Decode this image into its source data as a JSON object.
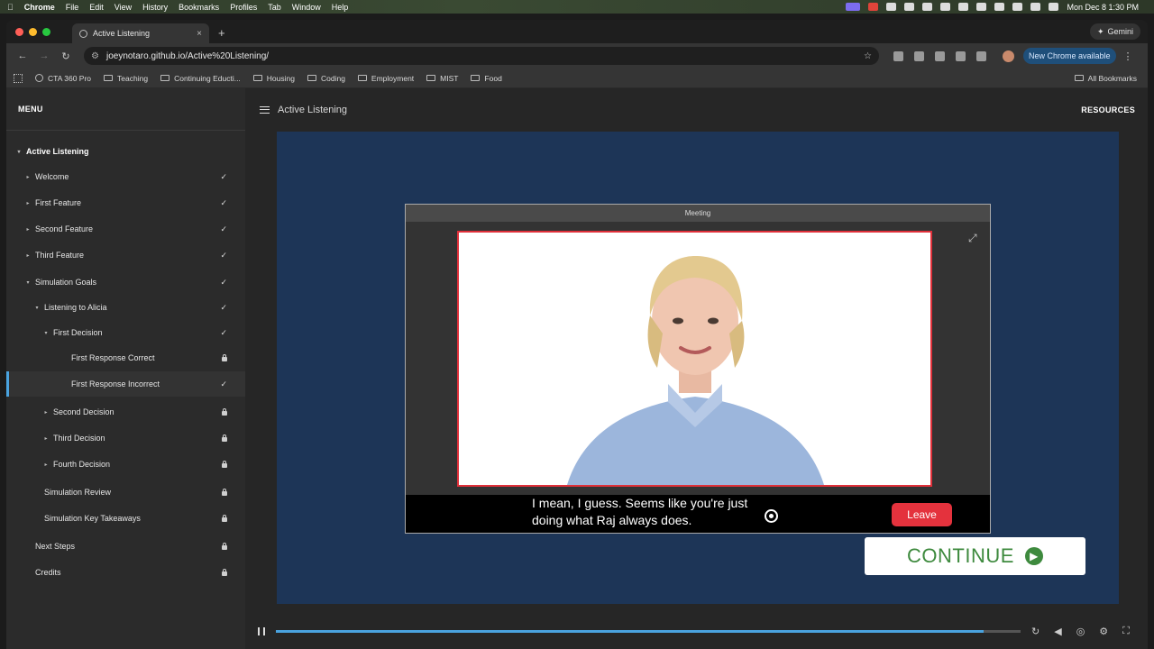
{
  "menubar": {
    "apple": "",
    "items": [
      "Chrome",
      "File",
      "Edit",
      "View",
      "History",
      "Bookmarks",
      "Profiles",
      "Tab",
      "Window",
      "Help"
    ],
    "datetime": "Mon Dec 8  1:30 PM"
  },
  "browser": {
    "tab_title": "Active Listening",
    "new_tab": "+",
    "gemini_label": "Gemini",
    "url": "joeynotaro.github.io/Active%20Listening/",
    "update_label": "New Chrome available",
    "bookmarks": [
      {
        "label": "CTA 360 Pro",
        "type": "site"
      },
      {
        "label": "Teaching",
        "type": "folder"
      },
      {
        "label": "Continuing Educti...",
        "type": "folder"
      },
      {
        "label": "Housing",
        "type": "folder"
      },
      {
        "label": "Coding",
        "type": "folder"
      },
      {
        "label": "Employment",
        "type": "folder"
      },
      {
        "label": "MIST",
        "type": "folder"
      },
      {
        "label": "Food",
        "type": "folder"
      }
    ],
    "all_bookmarks": "All Bookmarks"
  },
  "sidebar": {
    "menu_label": "MENU",
    "items": [
      {
        "label": "Active Listening",
        "level": 0,
        "caret": "▾",
        "status": ""
      },
      {
        "label": "Welcome",
        "level": 1,
        "caret": "▸",
        "status": "✓"
      },
      {
        "label": "First Feature",
        "level": 1,
        "caret": "▸",
        "status": "✓"
      },
      {
        "label": "Second Feature",
        "level": 1,
        "caret": "▸",
        "status": "✓"
      },
      {
        "label": "Third Feature",
        "level": 1,
        "caret": "▸",
        "status": "✓"
      },
      {
        "label": "Simulation Goals",
        "level": 1,
        "caret": "▾",
        "status": "✓"
      },
      {
        "label": "Listening to Alicia",
        "level": 2,
        "caret": "▾",
        "status": "✓"
      },
      {
        "label": "First Decision",
        "level": 3,
        "caret": "▾",
        "status": "✓"
      },
      {
        "label": "First Response Correct",
        "level": 4,
        "caret": "",
        "status": "lock"
      },
      {
        "label": "First Response Incorrect",
        "level": 4,
        "caret": "",
        "status": "✓"
      },
      {
        "label": "Second Decision",
        "level": 3,
        "caret": "▸",
        "status": "lock"
      },
      {
        "label": "Third Decision",
        "level": 3,
        "caret": "▸",
        "status": "lock"
      },
      {
        "label": "Fourth Decision",
        "level": 3,
        "caret": "▸",
        "status": "lock"
      },
      {
        "label": "Simulation Review",
        "level": 2,
        "caret": "",
        "status": "lock"
      },
      {
        "label": "Simulation Key Takeaways",
        "level": 2,
        "caret": "",
        "status": "lock"
      },
      {
        "label": "Next Steps",
        "level": 1,
        "caret": "",
        "status": "lock"
      },
      {
        "label": "Credits",
        "level": 1,
        "caret": "",
        "status": "lock"
      }
    ]
  },
  "header": {
    "course_title": "Active Listening",
    "resources": "RESOURCES"
  },
  "meeting": {
    "title": "Meeting",
    "caption_line1": "I mean, I guess. Seems like you're just",
    "caption_line2": "doing what Raj always does.",
    "leave_label": "Leave"
  },
  "continue_label": "CONTINUE",
  "player": {
    "progress": 0.95
  },
  "colors": {
    "stage_bg": "#1d3557",
    "accent": "#4aa3df",
    "leave_red": "#e4323d",
    "continue_green": "#3e8a3e"
  }
}
